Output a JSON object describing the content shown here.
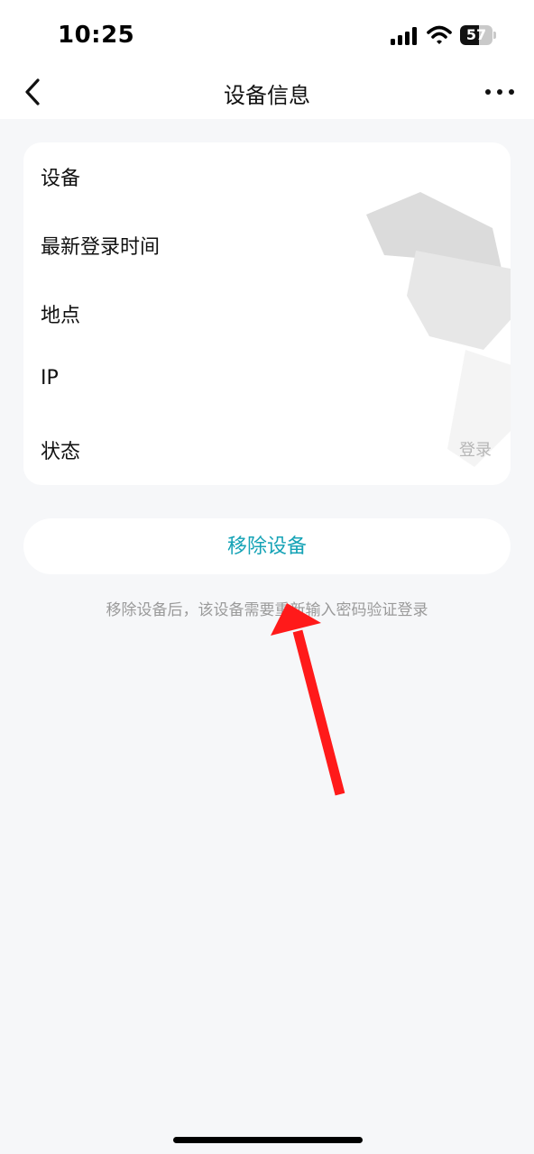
{
  "status_bar": {
    "time": "10:25",
    "battery_percent": "57",
    "icons": [
      "signal-icon",
      "wifi-icon",
      "battery-icon"
    ]
  },
  "nav": {
    "title": "设备信息",
    "back_icon": "chevron-left-icon",
    "more_icon": "more-horizontal-icon"
  },
  "info_rows": [
    {
      "label": "设备",
      "value": ""
    },
    {
      "label": "最新登录时间",
      "value": ""
    },
    {
      "label": "地点",
      "value": ""
    },
    {
      "label": "IP",
      "value": ""
    },
    {
      "label": "状态",
      "value": "登录"
    }
  ],
  "actions": {
    "remove_label": "移除设备",
    "remove_hint": "移除设备后，该设备需要重新输入密码验证登录"
  },
  "colors": {
    "accent": "#16a3b6",
    "annotation_arrow": "#ff1a1a",
    "background": "#f6f7f9",
    "card": "#ffffff"
  }
}
